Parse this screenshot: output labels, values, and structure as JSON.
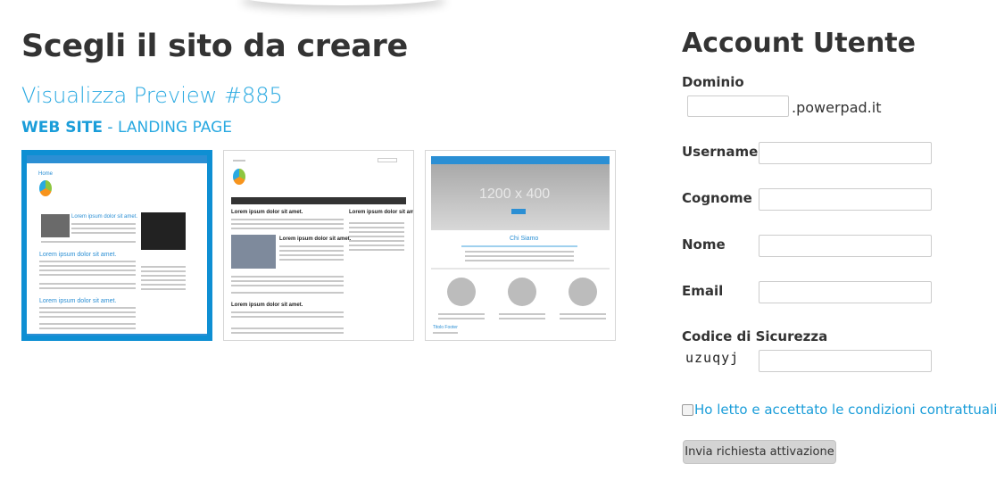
{
  "main": {
    "title": "Scegli il sito da creare",
    "preview_title": "Visualizza Preview #885",
    "category": {
      "web_site": "WEB SITE",
      "separator": " - ",
      "landing_page": "LANDING PAGE"
    },
    "templates": [
      {
        "selected": true,
        "header": "Home",
        "heading": "Lorem ipsum dolor sit amet."
      },
      {
        "selected": false,
        "heading": "Lorem ipsum dolor sit amet."
      },
      {
        "selected": false,
        "slider_text": "1200 x 400",
        "section_title": "Chi Siamo",
        "footer_title": "Titolo Footer"
      }
    ]
  },
  "account": {
    "title": "Account Utente",
    "domain_label": "Dominio",
    "domain_value": "",
    "domain_suffix": ".powerpad.it",
    "username_label": "Username",
    "username_value": "",
    "cognome_label": "Cognome",
    "cognome_value": "",
    "nome_label": "Nome",
    "nome_value": "",
    "email_label": "Email",
    "email_value": "",
    "security_label": "Codice di Sicurezza",
    "captcha_text": "uzuqyj",
    "security_value": "",
    "terms_checked": false,
    "terms_label": "Ho letto e accettato le condizioni contrattuali",
    "submit_label": "Invia richiesta attivazione"
  },
  "colors": {
    "accent": "#1a9dd9",
    "selected_border": "#0e8fd3",
    "button_bg": "#d4d4d4"
  }
}
